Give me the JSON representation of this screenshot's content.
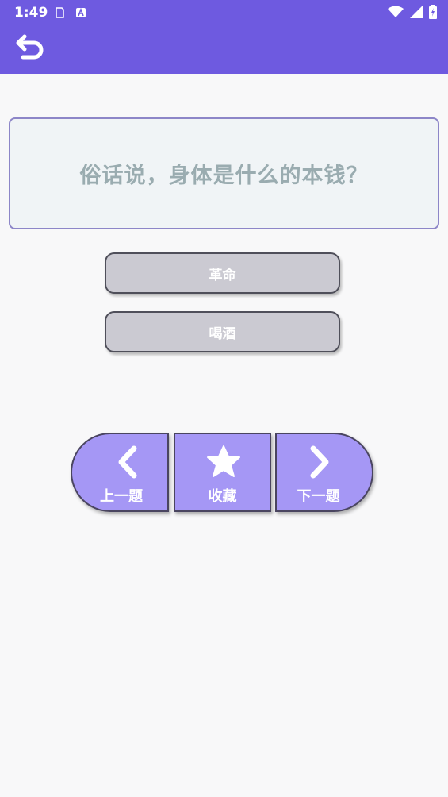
{
  "status_bar": {
    "time": "1:49",
    "icons": [
      "sd-card-icon",
      "a-badge-icon",
      "wifi-icon",
      "signal-icon",
      "battery-charging-icon"
    ]
  },
  "app_bar": {
    "back_icon": "undo-arrow-icon"
  },
  "question": {
    "text": "俗话说，身体是什么的本钱？"
  },
  "options": [
    {
      "label": "革命"
    },
    {
      "label": "喝酒"
    }
  ],
  "nav": {
    "prev_label": "上一题",
    "fav_label": "收藏",
    "next_label": "下一题"
  },
  "colors": {
    "primary": "#6e5ae0",
    "nav_button": "#a597f5",
    "option_bg": "#cbcad2",
    "question_text": "#9aacb0"
  }
}
